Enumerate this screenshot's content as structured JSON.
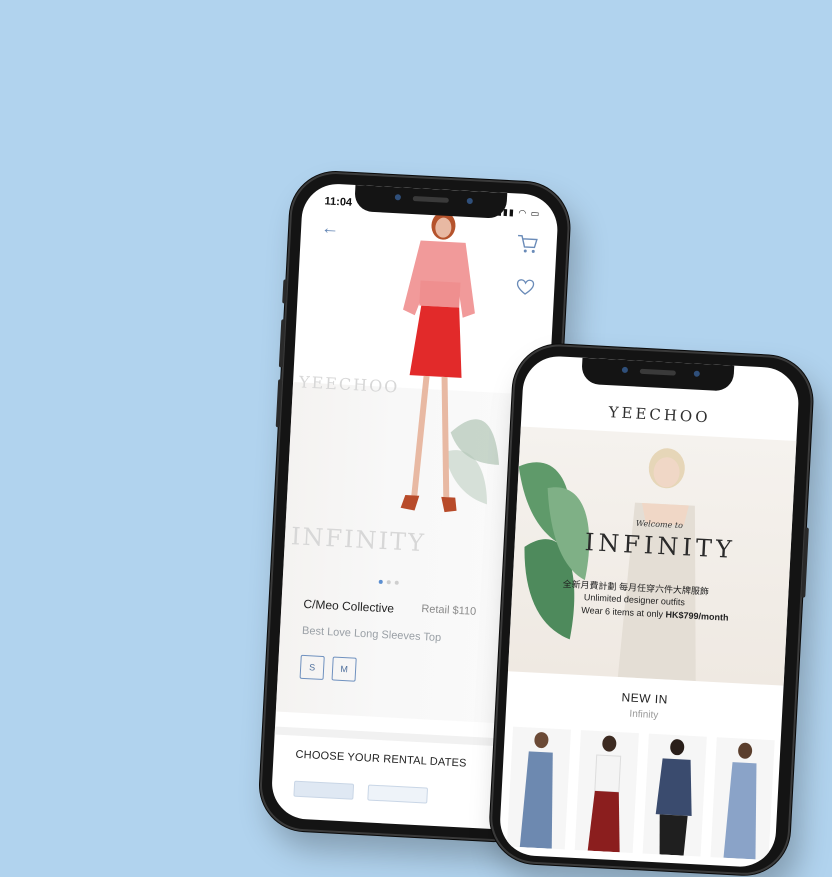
{
  "colors": {
    "background": "#b1d3ee",
    "accent": "#5c8fd1",
    "phone": "#141414"
  },
  "product_screen": {
    "status_time": "11:04",
    "back_icon": "arrow-left-icon",
    "cart_icon": "cart-icon",
    "favorite_icon": "heart-icon",
    "brand": "C/Meo Collective",
    "retail_label": "Retail $110",
    "product_name": "Best Love Long Sleeves Top",
    "sizes": [
      "S",
      "M"
    ],
    "rental_heading": "CHOOSE YOUR RENTAL DATES",
    "faded_logo": "YEECHOO",
    "faded_word": "INFINITY"
  },
  "home_screen": {
    "logo": "YEECHOO",
    "welcome": "Welcome to",
    "infinity": "INFINITY",
    "chinese_tagline": "全新月費計劃 每月任穿六件大牌服飾",
    "line1": "Unlimited designer outfits",
    "line2_prefix": "Wear 6 items at only ",
    "line2_price": "HK$799/month",
    "new_in": "NEW IN",
    "new_in_sub": "Infinity"
  }
}
